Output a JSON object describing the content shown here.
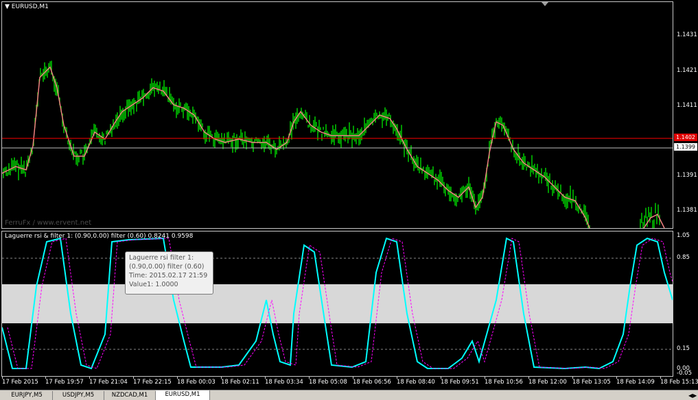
{
  "main_chart": {
    "title": "EURUSD,M1",
    "watermark": "FerruFx / www.ervent.net",
    "price_labels": [
      "1.1431",
      "1.1421",
      "1.1411",
      "1.1391",
      "1.1381"
    ],
    "current_price_tag": "1.1402",
    "bid_line_tag": "1.1399",
    "colors": {
      "candles": "#00ff00",
      "ma": "#f08080",
      "current_price_line": "#ff0000",
      "bid_line": "#c0c0c0"
    }
  },
  "indicator": {
    "title": "Laguerre rsi & filter 1: (0.90,0.00) filter (0.60) 0.8241 0.9598",
    "levels": [
      "1.05",
      "0.85",
      "0.15",
      "0.00",
      "-0.05"
    ],
    "colors": {
      "main_line": "#00ffff",
      "signal_line": "#ff00ff",
      "zone": "#d8d8d8"
    },
    "tooltip": {
      "line1": "Laguerre rsi  filter 1:",
      "line2": "(0.90,0.00) filter (0.60)",
      "line3": "Time: 2015.02.17 21:59",
      "line4": "Value1: 1.0000"
    }
  },
  "time_axis": [
    "17 Feb 2015",
    "17 Feb 19:57",
    "17 Feb 21:04",
    "17 Feb 22:15",
    "18 Feb 00:03",
    "18 Feb 02:11",
    "18 Feb 03:34",
    "18 Feb 05:08",
    "18 Feb 06:56",
    "18 Feb 08:40",
    "18 Feb 09:51",
    "18 Feb 10:56",
    "18 Feb 12:00",
    "18 Feb 13:05",
    "18 Feb 14:09",
    "18 Feb 15:13"
  ],
  "tabs": [
    {
      "label": "EURJPY,M5",
      "active": false
    },
    {
      "label": "USDJPY,M5",
      "active": false
    },
    {
      "label": "NZDCAD,M1",
      "active": false
    },
    {
      "label": "EURUSD,M1",
      "active": true
    }
  ]
}
